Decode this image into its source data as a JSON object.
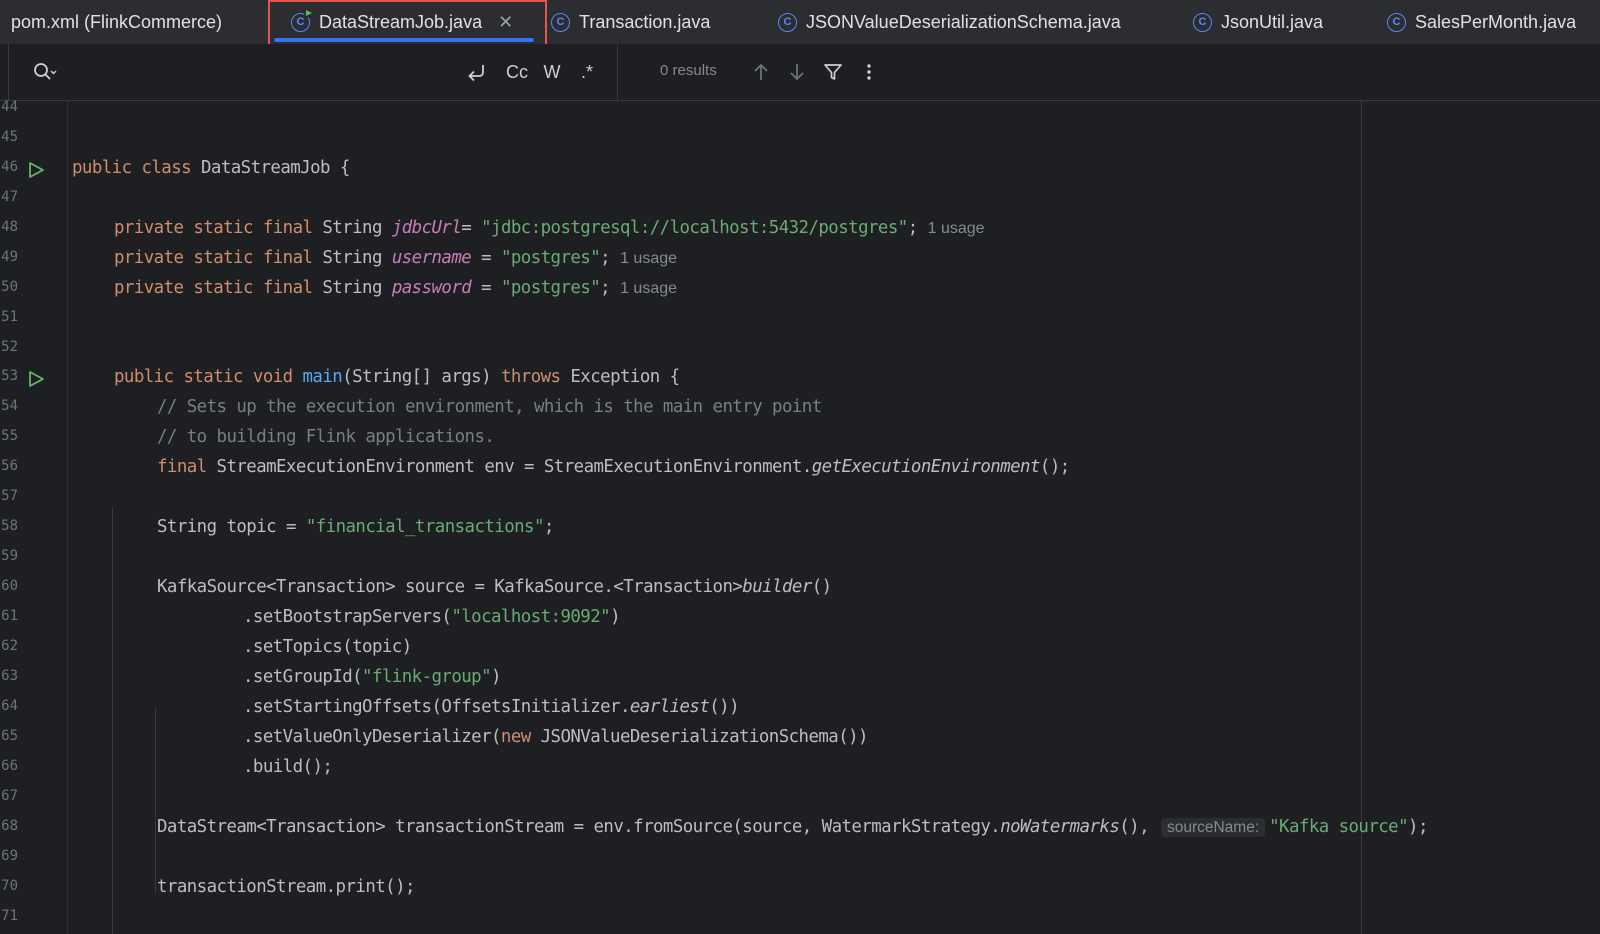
{
  "tabs": [
    {
      "label": "pom.xml (FlinkCommerce)",
      "icon": "maven-icon",
      "active": false
    },
    {
      "label": "DataStreamJob.java",
      "icon": "java-class-run-icon",
      "active": true
    },
    {
      "label": "Transaction.java",
      "icon": "java-class-icon",
      "active": false
    },
    {
      "label": "JSONValueDeserializationSchema.java",
      "icon": "java-class-icon",
      "active": false
    },
    {
      "label": "JsonUtil.java",
      "icon": "java-class-icon",
      "active": false
    },
    {
      "label": "SalesPerMonth.java",
      "icon": "java-class-icon",
      "active": false
    }
  ],
  "find": {
    "results": "0 results",
    "match_case": "Cc",
    "words": "W",
    "regex": ".*"
  },
  "colors": {
    "keyword": "#cf8e6d",
    "string": "#6aab73",
    "field": "#c77dbb",
    "method_decl": "#56a8f5",
    "comment": "#7a7e85",
    "accent": "#3574f0",
    "highlight_box": "#e2564d"
  },
  "lines": [
    {
      "n": "44",
      "t": ""
    },
    {
      "n": "45",
      "t": ""
    },
    {
      "n": "46",
      "p": [
        "public",
        " ",
        "class",
        " DataStreamJob {"
      ]
    },
    {
      "n": "47",
      "t": ""
    },
    {
      "n": "48",
      "p": [
        "private",
        " ",
        "static",
        " ",
        "final",
        " String ",
        "jdbcUrl",
        "= ",
        "\"jdbc:postgresql://localhost:5432/postgres\"",
        ";",
        "1 usage"
      ]
    },
    {
      "n": "49",
      "p": [
        "private",
        " ",
        "static",
        " ",
        "final",
        " String ",
        "username",
        " = ",
        "\"postgres\"",
        ";",
        "1 usage"
      ]
    },
    {
      "n": "50",
      "p": [
        "private",
        " ",
        "static",
        " ",
        "final",
        " String ",
        "password",
        " = ",
        "\"postgres\"",
        ";",
        "1 usage"
      ]
    },
    {
      "n": "51",
      "t": ""
    },
    {
      "n": "52",
      "t": ""
    },
    {
      "n": "53",
      "p": [
        "public",
        " ",
        "static",
        " ",
        "void",
        " ",
        "main",
        "(String[] args) ",
        "throws",
        " Exception {"
      ]
    },
    {
      "n": "54",
      "p": [
        "// Sets up the execution environment, which is the main entry point"
      ]
    },
    {
      "n": "55",
      "p": [
        "// to building Flink applications."
      ]
    },
    {
      "n": "56",
      "p": [
        "final",
        " StreamExecutionEnvironment env = StreamExecutionEnvironment.",
        "getExecutionEnvironment",
        "();"
      ]
    },
    {
      "n": "57",
      "t": ""
    },
    {
      "n": "58",
      "p": [
        "String topic = ",
        "\"financial_transactions\"",
        ";"
      ]
    },
    {
      "n": "59",
      "t": ""
    },
    {
      "n": "60",
      "p": [
        "KafkaSource<Transaction> source = KafkaSource.<Transaction>",
        "builder",
        "()"
      ]
    },
    {
      "n": "61",
      "p": [
        ".setBootstrapServers(",
        "\"localhost:9092\"",
        ")"
      ]
    },
    {
      "n": "62",
      "p": [
        ".setTopics(topic)"
      ]
    },
    {
      "n": "63",
      "p": [
        ".setGroupId(",
        "\"flink-group\"",
        ")"
      ]
    },
    {
      "n": "64",
      "p": [
        ".setStartingOffsets(OffsetsInitializer.",
        "earliest",
        "())"
      ]
    },
    {
      "n": "65",
      "p": [
        ".setValueOnlyDeserializer(",
        "new",
        " JSONValueDeserializationSchema())"
      ]
    },
    {
      "n": "66",
      "p": [
        ".build();"
      ]
    },
    {
      "n": "67",
      "t": ""
    },
    {
      "n": "68",
      "p": [
        "DataStream<Transaction> transactionStream = env.fromSource(source, WatermarkStrategy.",
        "noWatermarks",
        "(), ",
        "sourceName:",
        "\"Kafka source\"",
        ");"
      ]
    },
    {
      "n": "69",
      "t": ""
    },
    {
      "n": "70",
      "p": [
        "transactionStream.print();"
      ]
    },
    {
      "n": "71",
      "t": ""
    }
  ]
}
